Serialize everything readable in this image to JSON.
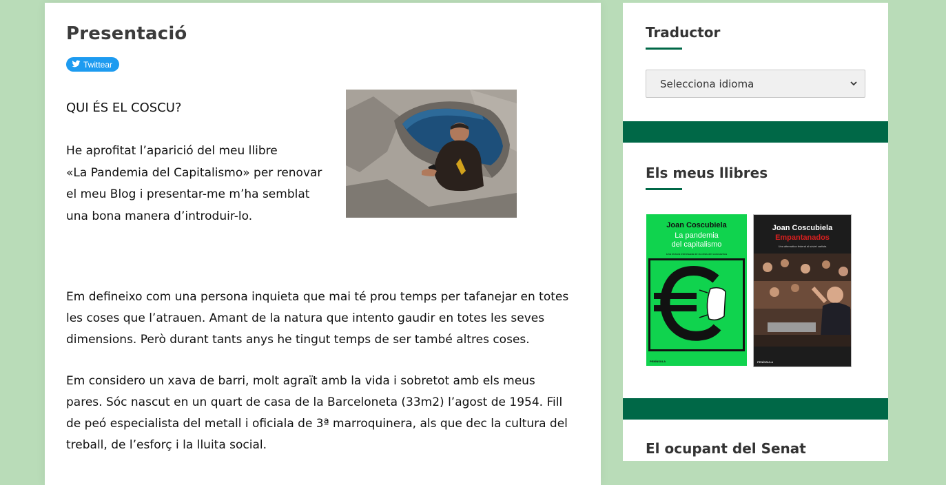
{
  "main": {
    "title": "Presentació",
    "tweet_label": "Twittear",
    "intro_heading": "QUI ÉS EL COSCU?",
    "intro_lines": [
      "He aprofitat l’aparició del meu llibre",
      "«La Pandemia del Capitalismo» per renovar",
      "el meu Blog i presentar-me m’ha semblat",
      "una bona manera d’introduir-lo."
    ],
    "paragraph_1": "Em defineixo com una persona inquieta que mai té prou temps per tafanejar en totes les coses que l’atrauen. Amant de la natura que intento gaudir en totes les seves dimensions. Però durant tants anys he tingut temps de ser també altres coses.",
    "paragraph_2": "Em considero un xava de barri, molt agraït amb la vida i sobretot amb els meus pares. Sóc nascut en un quart de casa de la Barceloneta (33m2) l’agost de 1954. Fill de peó especialista del metall i oficiala de 3ª marroquinera, als que dec la cultura del treball, de l’esforç i la lluita social."
  },
  "sidebar": {
    "translator_title": "Traductor",
    "language_select": "Selecciona idioma",
    "books_title": "Els meus llibres",
    "books": [
      {
        "author": "Joan Coscubiela",
        "title_line_1": "La pandemia",
        "title_line_2": "del capitalismo",
        "subtitle": "Una lectura interesada de la crisis del coronavirus",
        "publisher": "PENÍNSULA"
      },
      {
        "author": "Joan Coscubiela",
        "title_line_1": "Empantanados",
        "subtitle": "Una alternativa federal al sóviet carlista",
        "publisher": "PENÍNSULA"
      }
    ],
    "next_title": "El ocupant del Senat"
  },
  "colors": {
    "page_background": "#b9dcb8",
    "accent_green": "#006847",
    "book_green": "#10d34e",
    "twitter_blue": "#1d9bf0"
  },
  "icons": {
    "tweet": "twitter-bird-icon",
    "select": "chevron-down-icon"
  }
}
